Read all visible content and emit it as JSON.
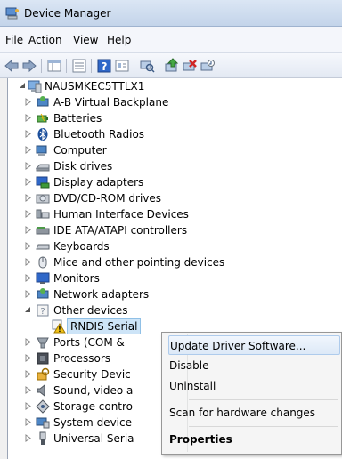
{
  "window": {
    "title": "Device Manager"
  },
  "menubar": {
    "items": [
      "File",
      "Action",
      "View",
      "Help"
    ]
  },
  "toolbar": {
    "buttons": [
      "back-icon",
      "forward-icon",
      "tree-view-icon",
      "list-view-icon",
      "help-icon",
      "properties-icon",
      "scan-hardware-icon",
      "update-driver-icon",
      "uninstall-icon",
      "disable-icon"
    ]
  },
  "tree": {
    "root": "NAUSMKEC5TTLX1",
    "categories": [
      "A-B Virtual Backplane",
      "Batteries",
      "Bluetooth Radios",
      "Computer",
      "Disk drives",
      "Display adapters",
      "DVD/CD-ROM drives",
      "Human Interface Devices",
      "IDE ATA/ATAPI controllers",
      "Keyboards",
      "Mice and other pointing devices",
      "Monitors",
      "Network adapters",
      "Other devices",
      "Ports (COM &",
      "Processors",
      "Security Devic",
      "Sound, video a",
      "Storage contro",
      "System device",
      "Universal Seria"
    ],
    "selected_device": "RNDIS Serial"
  },
  "context_menu": {
    "update_driver": "Update Driver Software...",
    "disable": "Disable",
    "uninstall": "Uninstall",
    "scan": "Scan for hardware changes",
    "properties": "Properties"
  }
}
